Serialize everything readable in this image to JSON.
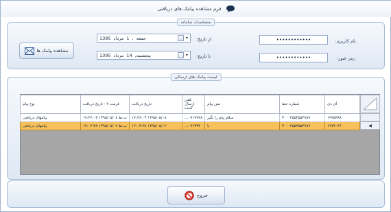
{
  "window": {
    "title": "فرم مشاهده پیامک های دریافتی",
    "title_icon": "chat-bubble-icon"
  },
  "system_group": {
    "caption": "مشخصات سامانه",
    "username_label": "نام کاربری:",
    "username_value": "••••••••••••",
    "password_label": "رمز عبور:",
    "password_value": "••••••••••••",
    "from_date_label": "از تاریخ:",
    "from_date_value": "جمعه ,   1    مرداد    1395",
    "to_date_label": "تا تاریخ:",
    "to_date_value": "پنجشنبه, 14   مرداد    1395",
    "view_button_label": "مشاهده پیامک ها",
    "view_button_icon": "envelope-icon"
  },
  "list_group": {
    "caption": "لیست پیامک های ارسالی",
    "columns": [
      "آی دی",
      "شماره خط",
      "متن پیام",
      "تلفن ارسال کننده",
      "تاریخ دریافت",
      "فرمت ۲ - تاریخ دریافت",
      "نوع پیام"
    ],
    "rows": [
      {
        "id": "۱۹۹۵۳۸۸",
        "line": "۳۰۰۰۴۵۵۴۵۵۴۷۸۷",
        "text": "سلام پیام را بگیر",
        "sender": "...۰۹۱۷۷۷۸",
        "date": "۱۷:۴۶:۰۳ ۱۳۹۵/۰۵/۰۸",
        "date2": "۱۷:۴۶:۰۳ ب.ظ ۱۳۹۵/۰۵/۰۸",
        "type": "پیامهای دریافتی",
        "selected": false
      },
      {
        "id": "۱۹۷۳۰۳۶",
        "line": "۳۰۰۰۴۵۵۴۵۵۴۷۸۷",
        "text": "با",
        "sender": "...۰۹۶۳۳۳",
        "date": "۱۲:۰۳:۳۸ ۱۳۹۵/۰۵/۰۲",
        "date2": "۱۲:۰۳:۳۸ ب.ظ ۱۳۹۵/۰۵/۰۲",
        "type": "پیامهای دریافتی",
        "selected": true
      }
    ]
  },
  "footer": {
    "exit_label": "خروج",
    "exit_icon": "no-entry-icon"
  }
}
